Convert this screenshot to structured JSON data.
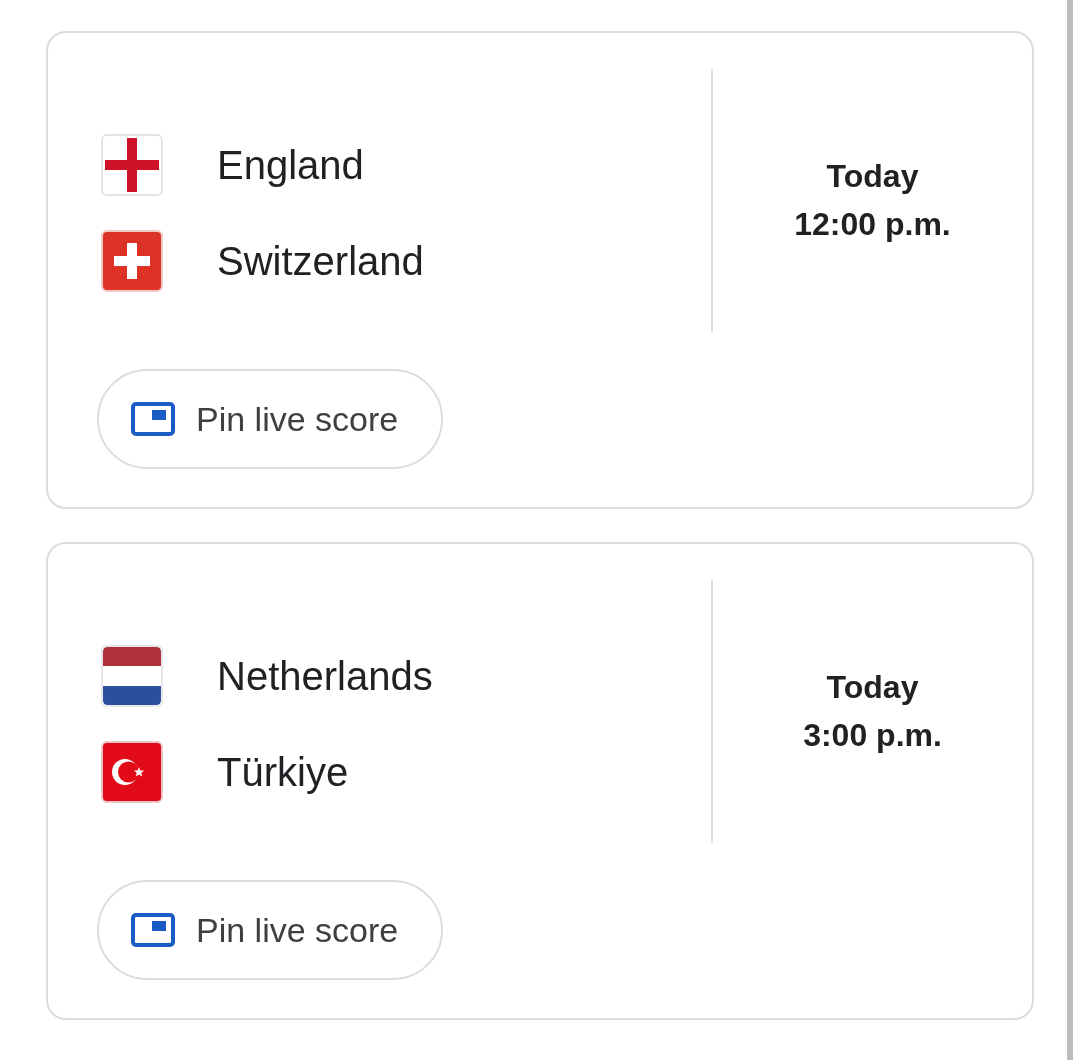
{
  "matches": [
    {
      "teams": [
        {
          "name": "England",
          "kind": "england"
        },
        {
          "name": "Switzerland",
          "kind": "switzerland"
        }
      ],
      "day": "Today",
      "time": "12:00 p.m.",
      "button": {
        "label": "Pin live score"
      }
    },
    {
      "teams": [
        {
          "name": "Netherlands",
          "kind": "netherlands"
        },
        {
          "name": "Türkiye",
          "kind": "turkiye"
        }
      ],
      "day": "Today",
      "time": "3:00 p.m.",
      "button": {
        "label": "Pin live score"
      }
    }
  ]
}
